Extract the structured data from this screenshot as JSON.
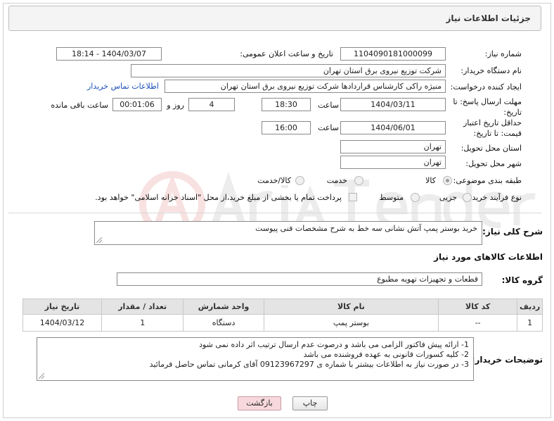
{
  "header": {
    "title": "جزئیات اطلاعات نیاز"
  },
  "fields": {
    "need_number_label": "شماره نیاز:",
    "need_number": "1104090181000099",
    "announce_label": "تاریخ و ساعت اعلان عمومی:",
    "announce_value": "1404/03/07 - 18:14",
    "buyer_org_label": "نام دستگاه خریدار:",
    "buyer_org": "شرکت توزیع نیروی برق استان تهران",
    "creator_label": "ایجاد کننده درخواست:",
    "creator": "منیژه راکی کارشناس قراردادها شرکت توزیع نیروی برق استان تهران",
    "buyer_contact_link": "اطلاعات تماس خریدار",
    "deadline_label": "مهلت ارسال پاسخ: تا تاریخ:",
    "deadline_date": "1404/03/11",
    "time_label": "ساعت",
    "deadline_time": "18:30",
    "days_value": "4",
    "days_label": "روز و",
    "remaining_time": "00:01:06",
    "remaining_label": "ساعت باقی مانده",
    "price_validity_label": "حداقل تاریخ اعتبار قیمت: تا تاریخ:",
    "price_validity_date": "1404/06/01",
    "price_validity_time": "16:00",
    "delivery_province_label": "استان محل تحویل:",
    "delivery_province": "تهران",
    "delivery_city_label": "شهر محل تحویل:",
    "delivery_city": "تهران",
    "category_label": "طبقه بندی موضوعی:",
    "category_options": [
      "کالا",
      "خدمت",
      "کالا/خدمت"
    ],
    "process_label": "نوع فرآیند خرید :",
    "process_options": [
      "جزیی",
      "متوسط"
    ],
    "payment_note": "پرداخت تمام یا بخشی از مبلغ خرید،از محل \"اسناد خزانه اسلامی\" خواهد بود."
  },
  "description": {
    "label": "شرح کلی نیاز:",
    "value": "خرید بوستر پمپ آتش نشانی سه خط به شرح مشخصات فنی پیوست"
  },
  "goods_section": {
    "title": "اطلاعات کالاهای مورد نیاز",
    "group_label": "گروه کالا:",
    "group_value": "قطعات و تجهیزات تهویه مطبوع"
  },
  "table": {
    "headers": [
      "ردیف",
      "کد کالا",
      "نام کالا",
      "واحد شمارش",
      "تعداد / مقدار",
      "تاریخ نیاز"
    ],
    "rows": [
      [
        "1",
        "--",
        "بوستر پمپ",
        "دستگاه",
        "1",
        "1404/03/12"
      ]
    ]
  },
  "buyer_notes": {
    "label": "توضیحات خریدار:",
    "lines": [
      "1- ارائه پیش فاکتور الزامی می باشد و درصوت عدم ارسال ترتیب اثر داده نمی شود",
      "2- کلیه کسورات قانونی به عهده فروشنده می باشد",
      "3- در صورت نیاز به اطلاعات بیشتر با شماره ی 09123967297 آقای کرمانی تماس حاصل فرمائید"
    ]
  },
  "buttons": {
    "print": "چاپ",
    "back": "بازگشت"
  },
  "colors": {
    "link": "#1a4fb5",
    "back_button": "#f7d9dd",
    "table_header": "#e4e4e4"
  }
}
